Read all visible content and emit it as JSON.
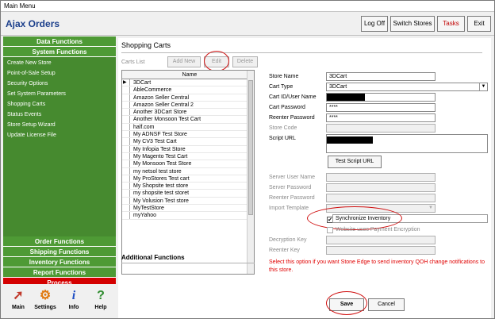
{
  "window": {
    "title": "Main Menu"
  },
  "header": {
    "app_title": "Ajax Orders",
    "buttons": [
      "Log Off",
      "Switch Stores",
      "Tasks",
      "Exit"
    ]
  },
  "sidebar": {
    "data_functions": "Data Functions",
    "system_functions": "System Functions",
    "system_items": [
      "Create New Store",
      "Point-of-Sale Setup",
      "Security Options",
      "Set System Parameters",
      "Shopping Carts",
      "Status Events",
      "Store Setup Wizard",
      "Update License File"
    ],
    "order_functions": "Order Functions",
    "shipping_functions": "Shipping Functions",
    "inventory_functions": "Inventory Functions",
    "report_functions": "Report Functions",
    "process": "Process",
    "tools": [
      {
        "label": "Main",
        "icon": "main-arrow-icon"
      },
      {
        "label": "Settings",
        "icon": "settings-gear-icon"
      },
      {
        "label": "Info",
        "icon": "info-icon"
      },
      {
        "label": "Help",
        "icon": "help-icon"
      }
    ]
  },
  "main": {
    "title": "Shopping Carts",
    "carts_list_label": "Carts List",
    "add_new": "Add New",
    "edit": "Edit",
    "delete": "Delete",
    "column_name": "Name",
    "carts": [
      "3DCart",
      "AbleCommerce",
      "Amazon Seller Central",
      "Amazon Seller Central 2",
      "Another 3DCart Store",
      "Another Monsoon Test Cart",
      "half.com",
      "My ADNSF Test Store",
      "My CV3 Test Cart",
      "My Infopia Test Store",
      "My Magento Test Cart",
      "My Monsoon Test Store",
      "my netsol test store",
      "My ProStores Test cart",
      "My Shopsite test store",
      "my shopsite test storet",
      "My Volusion Test store",
      "MyTestStore",
      "myYahoo"
    ],
    "additional_functions": "Additional Functions",
    "form": {
      "store_name_label": "Store Name",
      "store_name": "3DCart",
      "cart_type_label": "Cart Type",
      "cart_type": "3DCart",
      "cart_id_label": "Cart ID/User Name",
      "cart_password_label": "Cart Password",
      "cart_password": "****",
      "reenter_password_label": "Reenter Password",
      "reenter_password": "****",
      "store_code_label": "Store Code",
      "script_url_label": "Script URL",
      "test_script_url": "Test Script URL",
      "server_user_label": "Server User Name",
      "server_password_label": "Server Password",
      "reenter_password2_label": "Reenter Password",
      "import_template_label": "Import Template",
      "sync_inventory": "Synchronize Inventory",
      "website_encryption": "Website uses Payment Encryption",
      "decryption_key_label": "Decryption Key",
      "reenter_key_label": "Reenter Key",
      "note": "Select this option if you want Stone Edge to send inventory QOH change notifications to this store.",
      "save": "Save",
      "cancel": "Cancel"
    }
  }
}
